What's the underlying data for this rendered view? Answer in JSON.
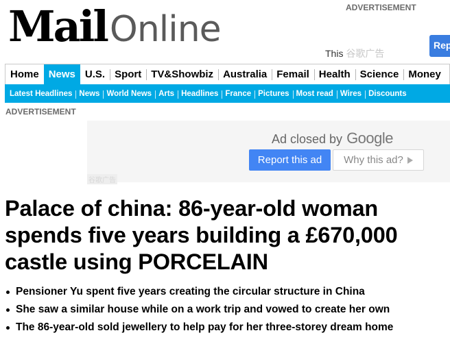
{
  "masthead": {
    "logo_bold": "Mail",
    "logo_light": "Online"
  },
  "top_ad": {
    "label": "ADVERTISEMENT",
    "button_label": "Rep",
    "text_visible": "This",
    "text_faded": "谷歌广告"
  },
  "nav": {
    "primary": [
      "Home",
      "News",
      "U.S.",
      "Sport",
      "TV&Showbiz",
      "Australia",
      "Femail",
      "Health",
      "Science",
      "Money"
    ],
    "active": "News",
    "secondary": [
      "Latest Headlines",
      "News",
      "World News",
      "Arts",
      "Headlines",
      "France",
      "Pictures",
      "Most read",
      "Wires",
      "Discounts"
    ]
  },
  "ad": {
    "label": "ADVERTISEMENT",
    "closed_text": "Ad closed by",
    "closed_brand": "Google",
    "report_label": "Report this ad",
    "why_label": "Why this ad?",
    "watermark": "谷歌广告"
  },
  "article": {
    "headline": "Palace of china: 86-year-old woman spends five years building a £670,000 castle using PORCELAIN",
    "bullets": [
      "Pensioner Yu spent five years creating the circular structure in China",
      "She saw a similar house while on a work trip and vowed to create her own",
      "The 86-year-old sold jewellery to help pay for her three-storey dream home"
    ]
  },
  "colors": {
    "nav_blue": "#00a9e4",
    "google_blue": "#4285f4"
  }
}
